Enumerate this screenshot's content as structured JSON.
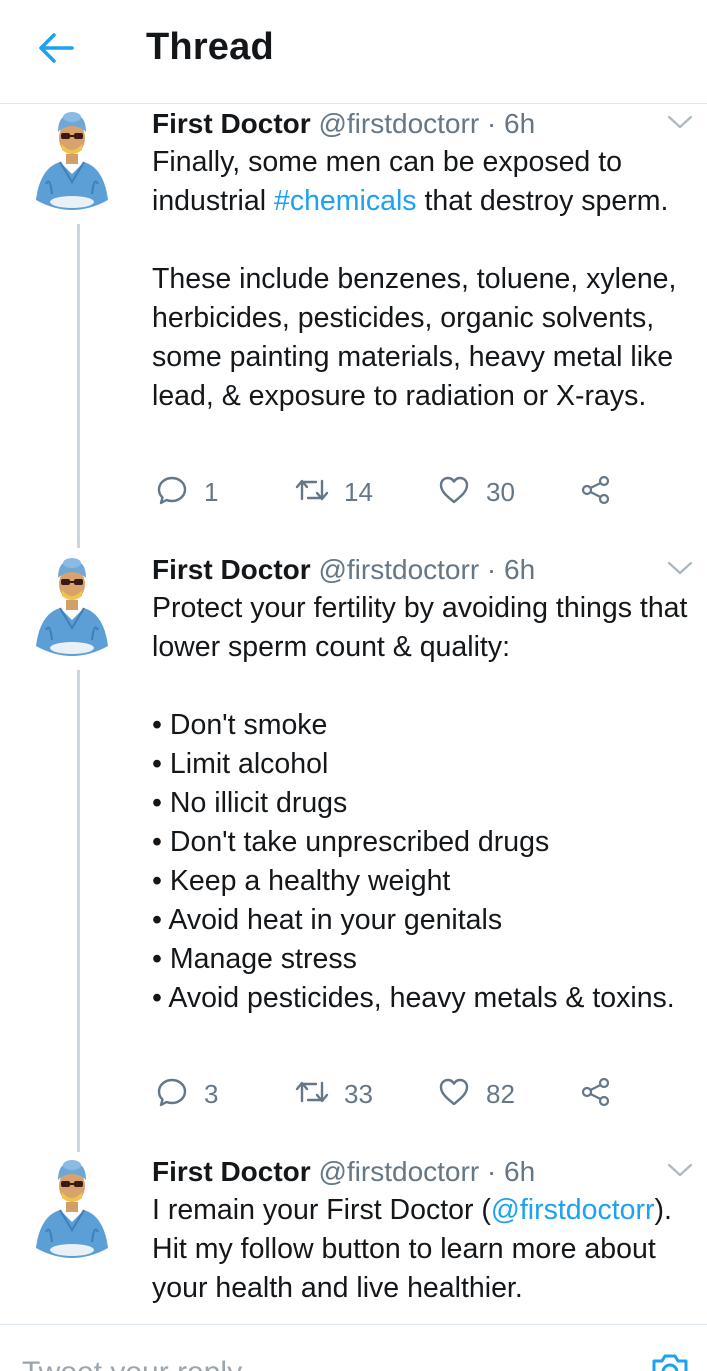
{
  "header": {
    "title": "Thread"
  },
  "tweets": [
    {
      "author": "First Doctor",
      "handle": "@firstdoctorr",
      "separator": "·",
      "time": "6h",
      "body": {
        "line1_pre": "Finally, some men can be exposed to industrial ",
        "hashtag": "#chemicals",
        "line1_post": " that destroy sperm.",
        "para2": "These include benzenes, toluene, xylene, herbicides, pesticides, organic solvents, some painting materials, heavy metal like lead, & exposure to radiation or X-rays."
      },
      "replies": "1",
      "retweets": "14",
      "likes": "30"
    },
    {
      "author": "First Doctor",
      "handle": "@firstdoctorr",
      "separator": "·",
      "time": "6h",
      "body": {
        "intro": "Protect your fertility by avoiding things that lower sperm count & quality:",
        "bullets": [
          "• Don't smoke",
          "• Limit alcohol",
          "• No illicit drugs",
          "• Don't take unprescribed drugs",
          "• Keep a healthy weight",
          "• Avoid heat in your genitals",
          "• Manage stress",
          "• Avoid pesticides, heavy metals & toxins."
        ]
      },
      "replies": "3",
      "retweets": "33",
      "likes": "82"
    },
    {
      "author": "First Doctor",
      "handle": "@firstdoctorr",
      "separator": "·",
      "time": "6h",
      "body": {
        "pre": "I remain your First Doctor (",
        "mention": "@firstdoctorr",
        "post": "). Hit my follow button to learn more about your health and live healthier."
      }
    }
  ],
  "reply_bar": {
    "placeholder": "Tweet your reply"
  },
  "colors": {
    "accent": "#1da1f2",
    "text": "#14171a",
    "muted": "#657786",
    "divider": "#e1e8ed",
    "thread_line": "#ccd6dd"
  },
  "icons": [
    "back-arrow-icon",
    "chevron-down-icon",
    "reply-icon",
    "retweet-icon",
    "like-icon",
    "share-icon",
    "camera-icon"
  ]
}
